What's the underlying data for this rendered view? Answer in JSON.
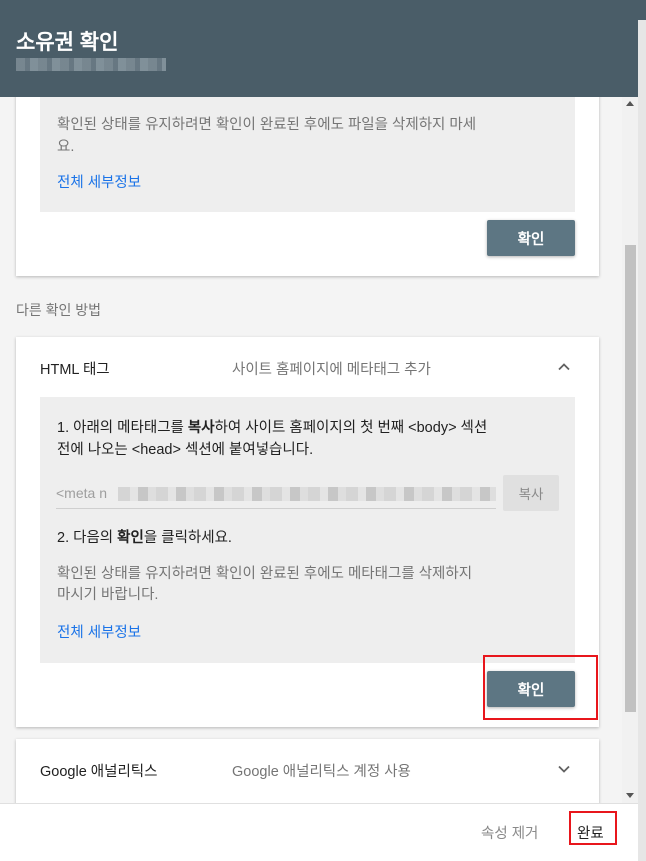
{
  "header": {
    "title": "소유권 확인"
  },
  "card1": {
    "note": "확인된 상태를 유지하려면 확인이 완료된 후에도 파일을 삭제하지 마세요.",
    "note_line1": "확인된 상태를 유지하려면 확인이 완료된 후에도 파일을 삭제하지 마세",
    "note_line2": "요.",
    "details_link": "전체 세부정보",
    "verify_button": "확인"
  },
  "other_methods_label": "다른 확인 방법",
  "html_tag": {
    "title": "HTML 태그",
    "description": "사이트 홈페이지에 메타태그 추가",
    "step1_line1_pre": "1. 아래의 메타태그를 ",
    "step1_line1_bold": "복사",
    "step1_line1_post": "하여 사이트 홈페이지의 첫 번째 <body> 섹션",
    "step1_line2": "전에 나오는 <head> 섹션에 붙여넣습니다.",
    "meta_prefix": "<meta n",
    "copy_button": "복사",
    "step2_pre": "2. 다음의 ",
    "step2_bold": "확인",
    "step2_post": "을 클릭하세요.",
    "note_line1": "확인된 상태를 유지하려면 확인이 완료된 후에도 메타태그를 삭제하지",
    "note_line2": "마시기 바랍니다.",
    "details_link": "전체 세부정보",
    "verify_button": "확인"
  },
  "analytics": {
    "title": "Google 애널리틱스",
    "description": "Google 애널리틱스 계정 사용"
  },
  "footer": {
    "remove_property": "속성 제거",
    "done": "완료"
  },
  "colors": {
    "header_bg": "#4a5d68",
    "button_bg": "#5d7683",
    "link": "#1a73e8",
    "highlight": "#e8161c"
  }
}
